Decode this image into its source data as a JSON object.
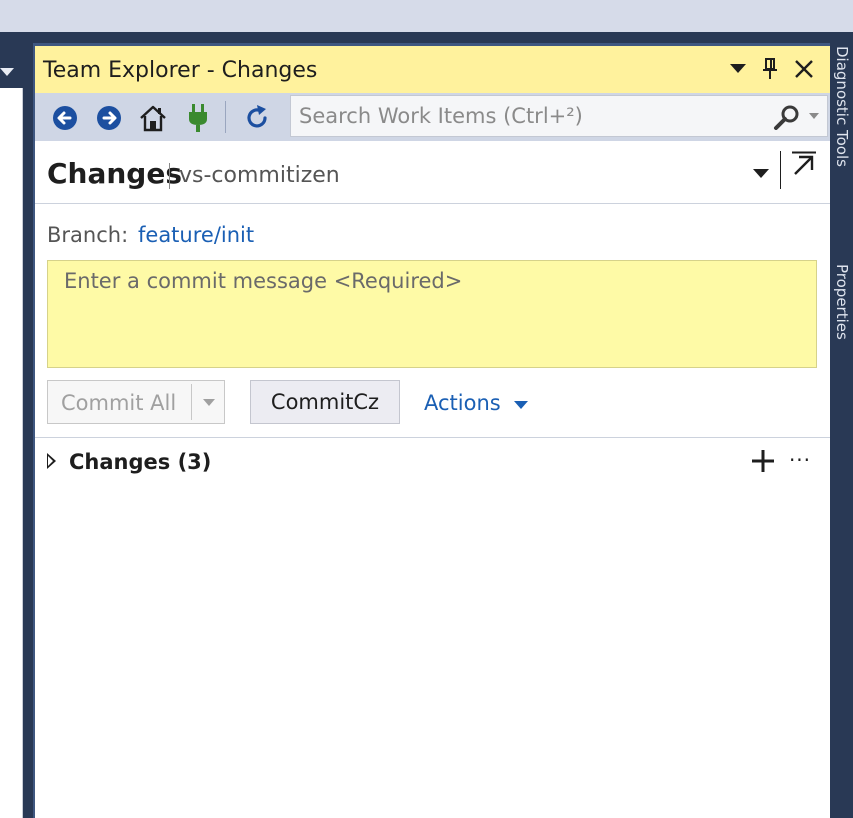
{
  "window": {
    "title": "Team Explorer - Changes"
  },
  "side_rail": {
    "labels": [
      "Diagnostic Tools",
      "Properties"
    ]
  },
  "toolbar": {
    "search_placeholder": "Search Work Items (Ctrl+²)"
  },
  "page": {
    "title": "Changes",
    "context": "vs-commitizen"
  },
  "branch": {
    "label": "Branch:",
    "name": "feature/init"
  },
  "commit": {
    "message_placeholder": "Enter a commit message <Required>",
    "message_value": "",
    "commit_all_label": "Commit All",
    "commit_cz_label": "CommitCz",
    "actions_label": "Actions"
  },
  "changes_section": {
    "title": "Changes (3)",
    "more_label": "···"
  },
  "colors": {
    "titlebar_bg": "#fff29d",
    "commit_box_bg": "#fefaa6",
    "link": "#1a5fb4",
    "frame": "#293955",
    "toolbar_bg": "#cfd6e5"
  }
}
